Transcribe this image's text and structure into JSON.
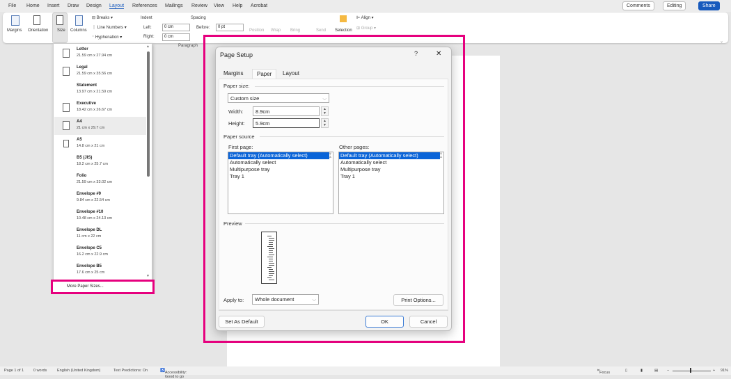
{
  "menu": {
    "items": [
      "File",
      "Home",
      "Insert",
      "Draw",
      "Design",
      "Layout",
      "References",
      "Mailings",
      "Review",
      "View",
      "Help",
      "Acrobat"
    ],
    "active": "Layout"
  },
  "topright": {
    "comments": "Comments",
    "editing": "Editing",
    "share": "Share"
  },
  "ribbon": {
    "margins": "Margins",
    "orientation": "Orientation",
    "size": "Size",
    "columns": "Columns",
    "breaks": "Breaks",
    "line_numbers": "Line Numbers",
    "hyphenation": "Hyphenation",
    "indent": "Indent",
    "spacing": "Spacing",
    "left_label": "Left:",
    "left_value": "0 cm",
    "right_label": "Right:",
    "right_value": "0 cm",
    "before_label": "Before:",
    "before_value": "0 pt",
    "paragraph": "Paragraph",
    "position": "Position",
    "wrap": "Wrap",
    "bring": "Bring",
    "send": "Send",
    "selection": "Selection",
    "align": "Align",
    "group": "Group"
  },
  "size_menu": {
    "items": [
      {
        "name": "Letter",
        "size": "21.59 cm x 27.94 cm",
        "icon": true
      },
      {
        "name": "Legal",
        "size": "21.59 cm x 35.56 cm",
        "icon": true
      },
      {
        "name": "Statement",
        "size": "13.97 cm x 21.59 cm",
        "icon": false
      },
      {
        "name": "Executive",
        "size": "18.42 cm x 26.67 cm",
        "icon": true
      },
      {
        "name": "A4",
        "size": "21 cm x 29.7 cm",
        "icon": true,
        "selected": true
      },
      {
        "name": "A5",
        "size": "14.8 cm x 21 cm",
        "icon": true
      },
      {
        "name": "B5 (JIS)",
        "size": "18.2 cm x 25.7 cm",
        "icon": false
      },
      {
        "name": "Folio",
        "size": "21.59 cm x 33.02 cm",
        "icon": false
      },
      {
        "name": "Envelope #9",
        "size": "9.84 cm x 22.54 cm",
        "icon": false
      },
      {
        "name": "Envelope #10",
        "size": "10.48 cm x 24.13 cm",
        "icon": false
      },
      {
        "name": "Envelope DL",
        "size": "11 cm x 22 cm",
        "icon": false
      },
      {
        "name": "Envelope C5",
        "size": "16.2 cm x 22.9 cm",
        "icon": false
      },
      {
        "name": "Envelope B5",
        "size": "17.6 cm x 25 cm",
        "icon": false
      }
    ],
    "more": "More Paper Sizes..."
  },
  "dialog": {
    "title": "Page Setup",
    "help": "?",
    "close": "✕",
    "tabs": [
      "Margins",
      "Paper",
      "Layout"
    ],
    "active_tab": "Paper",
    "paper_size_label": "Paper size:",
    "paper_size_value": "Custom size",
    "width_label": "Width:",
    "width_value": "8.9cm",
    "height_label": "Height:",
    "height_value": "5.9cm",
    "paper_source_label": "Paper source",
    "first_page_label": "First page:",
    "other_pages_label": "Other pages:",
    "trays": [
      "Default tray (Automatically select)",
      "Automatically select",
      "Multipurpose tray",
      "Tray 1"
    ],
    "preview_label": "Preview",
    "apply_to_label": "Apply to:",
    "apply_to_value": "Whole document",
    "print_options": "Print Options...",
    "set_default": "Set As Default",
    "ok": "OK",
    "cancel": "Cancel"
  },
  "status": {
    "page": "Page 1 of 1",
    "words": "0 words",
    "language": "English (United Kingdom)",
    "predictions": "Text Predictions: On",
    "accessibility": "Accessibility: Good to go",
    "focus": "Focus",
    "zoom": "91%"
  },
  "colors": {
    "highlight": "#e6007e",
    "accent": "#185abd",
    "selection": "#0a64d8"
  }
}
